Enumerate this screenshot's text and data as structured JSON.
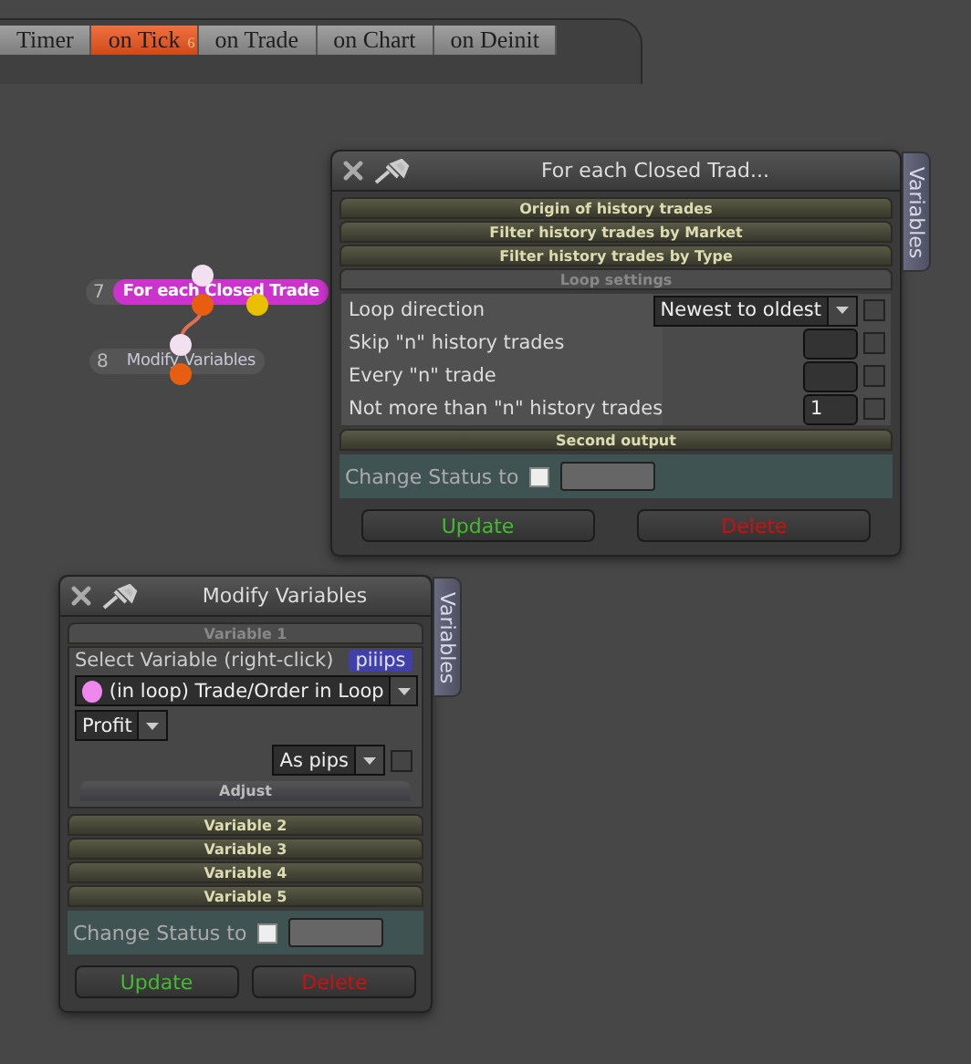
{
  "tabs": [
    {
      "label": "Timer",
      "selected": false
    },
    {
      "label": "on Tick",
      "badge": "6",
      "selected": true
    },
    {
      "label": "on Trade",
      "selected": false
    },
    {
      "label": "on Chart",
      "selected": false
    },
    {
      "label": "on Deinit",
      "selected": false
    }
  ],
  "nodes": [
    {
      "number": "7",
      "label": "For each Closed Trade",
      "selected": true
    },
    {
      "number": "8",
      "label": "Modify Variables",
      "selected": false
    }
  ],
  "loop_window": {
    "title": "For each Closed Trad...",
    "side_tab": "Variables",
    "sections": [
      {
        "title": "Origin of history trades",
        "expanded": false
      },
      {
        "title": "Filter history trades by Market",
        "expanded": false
      },
      {
        "title": "Filter history trades by Type",
        "expanded": false
      },
      {
        "title": "Loop settings",
        "expanded": true,
        "rows": [
          {
            "label": "Loop direction",
            "kind": "dropdown",
            "value": "Newest to oldest",
            "checked": false
          },
          {
            "label": "Skip \"n\" history trades",
            "kind": "input",
            "checked": false
          },
          {
            "label": "Every \"n\" trade",
            "kind": "input",
            "checked": false
          },
          {
            "label": "Not more than \"n\" history trades",
            "kind": "input",
            "value": "1",
            "checked": false
          }
        ]
      },
      {
        "title": "Second output",
        "expanded": false
      }
    ],
    "status": {
      "label": "Change Status to",
      "checked": false
    },
    "buttons": [
      {
        "label": "Update",
        "kind": "confirm"
      },
      {
        "label": "Delete",
        "kind": "danger"
      }
    ]
  },
  "modify_window": {
    "title": "Modify Variables",
    "side_tab": "Variables",
    "variables": [
      {
        "title": "Variable 1",
        "expanded": true,
        "select_label": "Select Variable (right-click)",
        "tag": "piiips",
        "source": {
          "label": "(in loop) Trade/Order in Loop",
          "color": "#ee88ee"
        },
        "property": "Profit",
        "format": {
          "value": "As pips",
          "checked": false
        },
        "adjust": "Adjust"
      },
      {
        "title": "Variable 2",
        "expanded": false
      },
      {
        "title": "Variable 3",
        "expanded": false
      },
      {
        "title": "Variable 4",
        "expanded": false
      },
      {
        "title": "Variable 5",
        "expanded": false
      }
    ],
    "status": {
      "label": "Change Status to",
      "checked": false
    },
    "buttons": [
      {
        "label": "Update",
        "kind": "confirm"
      },
      {
        "label": "Delete",
        "kind": "danger"
      }
    ]
  }
}
